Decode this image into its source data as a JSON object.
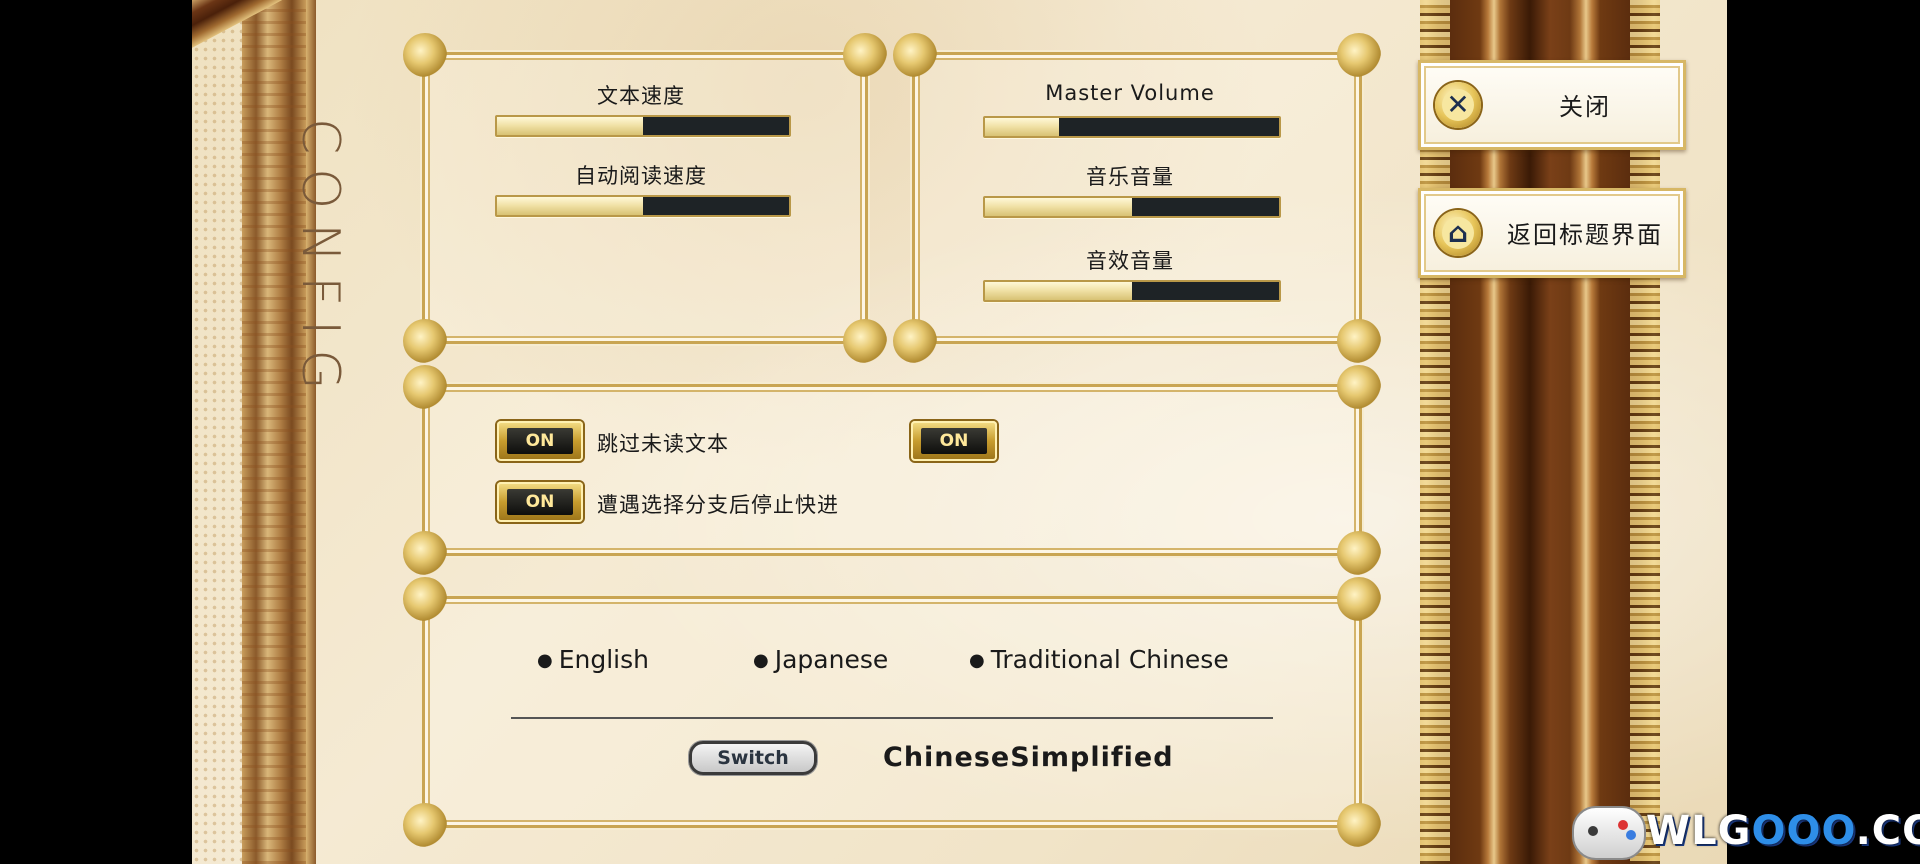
{
  "screen_title": "CONFIG",
  "text_panel": {
    "sliders": [
      {
        "label": "文本速度",
        "value": 0.5
      },
      {
        "label": "自动阅读速度",
        "value": 0.5
      }
    ]
  },
  "volume_panel": {
    "sliders": [
      {
        "label": "Master Volume",
        "value": 0.25
      },
      {
        "label": "音乐音量",
        "value": 0.5
      },
      {
        "label": "音效音量",
        "value": 0.5
      }
    ]
  },
  "options_panel": {
    "skip_unread": {
      "button_label": "ON",
      "label": "跳过未读文本"
    },
    "unlabeled_toggle": {
      "button_label": "ON"
    },
    "stop_skip_on_choice": {
      "button_label": "ON",
      "label": "遭遇选择分支后停止快进"
    }
  },
  "language_panel": {
    "options": [
      {
        "bullet": "●",
        "label": "English"
      },
      {
        "bullet": "●",
        "label": "Japanese"
      },
      {
        "bullet": "●",
        "label": "Traditional Chinese"
      }
    ],
    "switch_label": "Switch",
    "current_language": "ChineseSimplified"
  },
  "side_buttons": {
    "close": {
      "label": "关闭",
      "icon": "close-icon",
      "glyph": "✕"
    },
    "return_title": {
      "label": "返回标题界面",
      "icon": "home-icon",
      "glyph": "⌂"
    }
  },
  "watermark": {
    "prefix": "WLG",
    "highlight": "OOO",
    "suffix": ".COM"
  },
  "colors": {
    "gold": "#c9a552",
    "slider_fill": "#f1e2a8",
    "slider_track": "#1e2326",
    "on_text": "#ffe89a"
  }
}
